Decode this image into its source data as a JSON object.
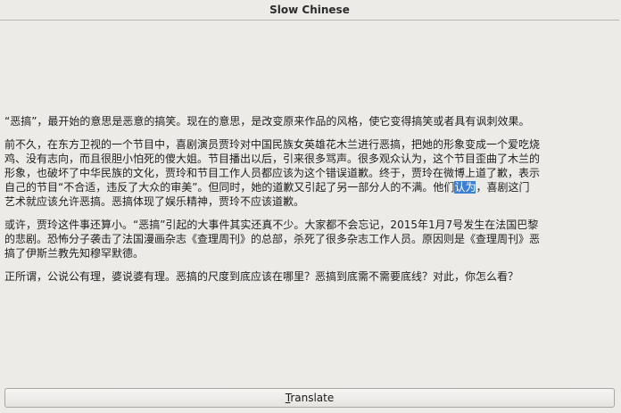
{
  "window": {
    "title": "Slow Chinese"
  },
  "article": {
    "p1": "“恶搞”，最开始的意思是恶意的搞笑。现在的意思，是改变原来作品的风格，使它变得搞笑或者具有讽刺效果。",
    "p2_before": "前不久，在东方卫视的一个节目中，喜剧演员贾玲对中国民族女英雄花木兰进行恶搞，把她的形象变成一个爱吃烧鸡、没有志向，而且很胆小怕死的傻大姐。节目播出以后，引来很多骂声。很多观众认为，这个节目歪曲了木兰的形象，也破坏了中华民族的文化，贾玲和节目工作人员都应该为这个错误道歉。终于，贾玲在微博上道了歉，表示自己的节目“不合适，违反了大众的审美”。但同时，她的道歉又引起了另一部分人的不满。他们",
    "p2_selected": "认为",
    "p2_after": "，喜剧这门艺术就应该允许恶搞。恶搞体现了娱乐精神，贾玲不应该道歉。",
    "p3": "或许，贾玲这件事还算小。“恶搞”引起的大事件其实还真不少。大家都不会忘记，2015年1月7号发生在法国巴黎的悲剧。恐怖分子袭击了法国漫画杂志《查理周刊》的总部，杀死了很多杂志工作人员。原因则是《查理周刊》恶搞了伊斯兰教先知穆罕默德。",
    "p4": "正所谓，公说公有理，婆说婆有理。恶搞的尺度到底应该在哪里？恶搞到底需不需要底线？对此，你怎么看？"
  },
  "translate_button": {
    "mnemonic": "T",
    "rest": "ranslate"
  }
}
